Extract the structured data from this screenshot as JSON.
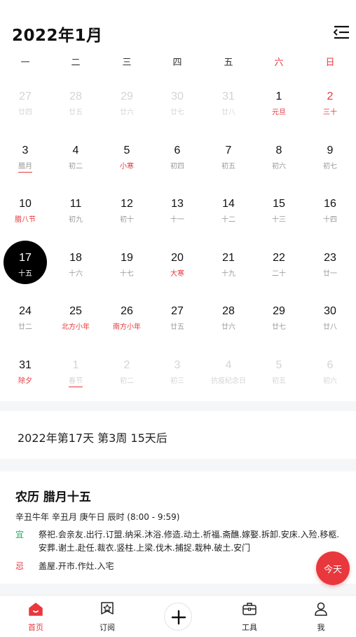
{
  "header": {
    "title": "2022年1月"
  },
  "weekdays": [
    "一",
    "二",
    "三",
    "四",
    "五",
    "六",
    "日"
  ],
  "calendar": {
    "weeks": [
      [
        {
          "day": "27",
          "lunar": "廿四",
          "faded": true
        },
        {
          "day": "28",
          "lunar": "廿五",
          "faded": true
        },
        {
          "day": "29",
          "lunar": "廿六",
          "faded": true
        },
        {
          "day": "30",
          "lunar": "廿七",
          "faded": true
        },
        {
          "day": "31",
          "lunar": "廿八",
          "faded": true
        },
        {
          "day": "1",
          "lunar": "元旦",
          "lunar_red": true
        },
        {
          "day": "2",
          "lunar": "三十",
          "day_red": true,
          "lunar_red": true
        }
      ],
      [
        {
          "day": "3",
          "lunar": "腊月",
          "underline": true
        },
        {
          "day": "4",
          "lunar": "初二"
        },
        {
          "day": "5",
          "lunar": "小寒",
          "lunar_red": true
        },
        {
          "day": "6",
          "lunar": "初四"
        },
        {
          "day": "7",
          "lunar": "初五"
        },
        {
          "day": "8",
          "lunar": "初六"
        },
        {
          "day": "9",
          "lunar": "初七"
        }
      ],
      [
        {
          "day": "10",
          "lunar": "腊八节",
          "lunar_red": true
        },
        {
          "day": "11",
          "lunar": "初九"
        },
        {
          "day": "12",
          "lunar": "初十"
        },
        {
          "day": "13",
          "lunar": "十一"
        },
        {
          "day": "14",
          "lunar": "十二"
        },
        {
          "day": "15",
          "lunar": "十三"
        },
        {
          "day": "16",
          "lunar": "十四"
        }
      ],
      [
        {
          "day": "17",
          "lunar": "十五",
          "selected": true
        },
        {
          "day": "18",
          "lunar": "十六"
        },
        {
          "day": "19",
          "lunar": "十七"
        },
        {
          "day": "20",
          "lunar": "大寒",
          "lunar_red": true
        },
        {
          "day": "21",
          "lunar": "十九"
        },
        {
          "day": "22",
          "lunar": "二十"
        },
        {
          "day": "23",
          "lunar": "廿一"
        }
      ],
      [
        {
          "day": "24",
          "lunar": "廿二"
        },
        {
          "day": "25",
          "lunar": "北方小年",
          "lunar_red": true
        },
        {
          "day": "26",
          "lunar": "南方小年",
          "lunar_red": true
        },
        {
          "day": "27",
          "lunar": "廿五"
        },
        {
          "day": "28",
          "lunar": "廿六"
        },
        {
          "day": "29",
          "lunar": "廿七"
        },
        {
          "day": "30",
          "lunar": "廿八"
        }
      ],
      [
        {
          "day": "31",
          "lunar": "除夕",
          "lunar_red": true
        },
        {
          "day": "1",
          "lunar": "春节",
          "faded": true,
          "underline": true
        },
        {
          "day": "2",
          "lunar": "初二",
          "faded": true
        },
        {
          "day": "3",
          "lunar": "初三",
          "faded": true
        },
        {
          "day": "4",
          "lunar": "抗疫纪念日",
          "faded": true
        },
        {
          "day": "5",
          "lunar": "初五",
          "faded": true
        },
        {
          "day": "6",
          "lunar": "初六",
          "faded": true
        }
      ]
    ]
  },
  "info": {
    "text": "2022年第17天 第3周 15天后"
  },
  "almanac": {
    "title": "农历 腊月十五",
    "subtitle": "辛丑牛年 辛丑月 庚午日 辰时 (8:00 - 9:59)",
    "yi_label": "宜",
    "yi_text": "祭祀.会亲友.出行.订盟.纳采.沐浴.修造.动土.祈福.斋醮.嫁娶.拆卸.安床.入殓.移柩.安葬.谢土.赴任.裁衣.竖柱.上梁.伐木.捕捉.栽种.破土.安门",
    "ji_label": "忌",
    "ji_text": "盖屋.开市.作灶.入宅"
  },
  "today_button": "今天",
  "tabs": [
    {
      "label": "首页",
      "icon": "home-icon",
      "active": true
    },
    {
      "label": "订阅",
      "icon": "subscribe-icon"
    },
    {
      "label": "工具",
      "icon": "toolbox-icon"
    },
    {
      "label": "我",
      "icon": "profile-icon"
    }
  ],
  "colors": {
    "accent": "#e8383d",
    "holiday_green": "#2fa866",
    "selected": "#000000"
  }
}
